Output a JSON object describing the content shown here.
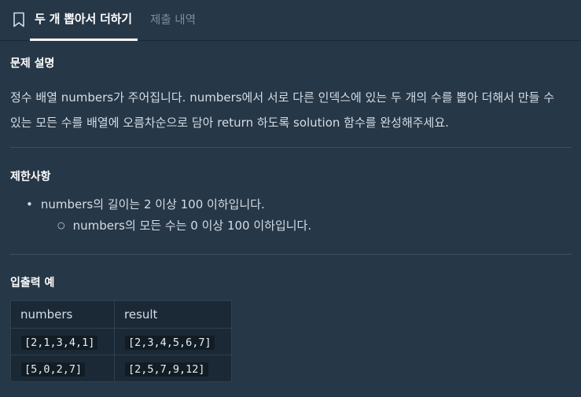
{
  "header": {
    "active_tab": "두 개 뽑아서 더하기",
    "inactive_tab": "제출 내역",
    "bookmark_icon": "bookmark-icon"
  },
  "problem": {
    "title": "문제 설명",
    "line1": "정수 배열 numbers가 주어집니다. numbers에서 서로 다른 인덱스에 있는 두 개의 수를 뽑아 더해서 만들 수",
    "line2": "있는 모든 수를 배열에 오름차순으로 담아 return 하도록 solution 함수를 완성해주세요."
  },
  "constraints": {
    "title": "제한사항",
    "item1": "numbers의 길이는 2 이상 100 이하입니다.",
    "item2": "numbers의 모든 수는 0 이상 100 이하입니다."
  },
  "examples": {
    "title": "입출력 예",
    "headers": [
      "numbers",
      "result"
    ],
    "rows": [
      [
        "[2,1,3,4,1]",
        "[2,3,4,5,6,7]"
      ],
      [
        "[5,0,2,7]",
        "[2,5,7,9,12]"
      ]
    ]
  },
  "colors": {
    "background": "#263747",
    "table_background": "#1b2936",
    "code_background": "#121c25",
    "inactive_tab": "#78909c"
  }
}
